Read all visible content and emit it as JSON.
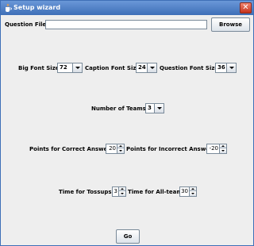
{
  "window": {
    "title": "Setup wizard"
  },
  "icons": {
    "app": "java-cup-icon",
    "close": "close-icon"
  },
  "question_file": {
    "label": "Question File:",
    "value": "",
    "browse_label": "Browse"
  },
  "fonts": {
    "big_label": "Big Font Size:",
    "big_value": "72",
    "caption_label": "Caption Font Size:",
    "caption_value": "24",
    "question_label": "Question Font Size:",
    "question_value": "36"
  },
  "teams": {
    "label": "Number of Teams:",
    "value": "3"
  },
  "points": {
    "correct_label": "Points for Correct Answer:",
    "correct_value": "20",
    "incorrect_label": "Points for Incorrect Answer:",
    "incorrect_value": "-20"
  },
  "times": {
    "tossups_label": "Time for Tossups:",
    "tossups_value": "3",
    "allteam_label": "Time for All-team:",
    "allteam_value": "30"
  },
  "go_label": "Go",
  "colors": {
    "titlebar": "#3e6fb7",
    "close": "#c6321b",
    "background": "#eeeeee"
  }
}
